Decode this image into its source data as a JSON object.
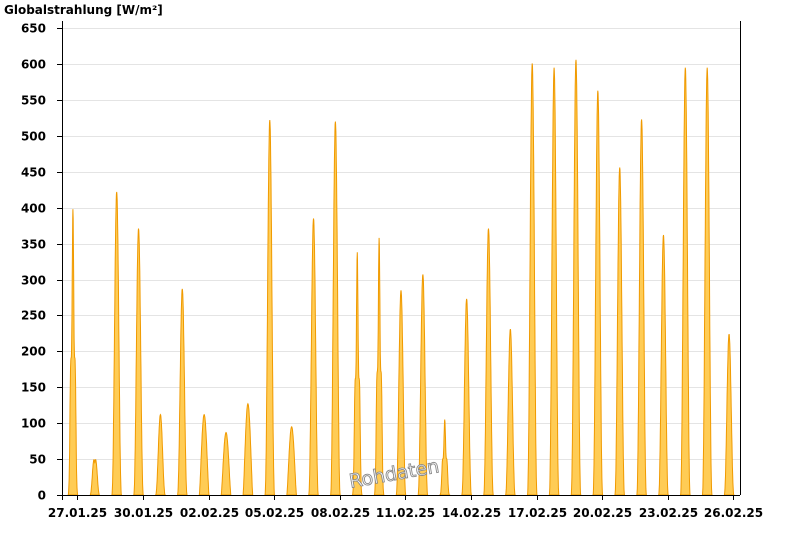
{
  "chart_data": {
    "type": "area",
    "ylabel": "Globalstrahlung [W/m²]",
    "xlabel": "",
    "ylim": [
      0,
      660
    ],
    "yticks": [
      0,
      50,
      100,
      150,
      200,
      250,
      300,
      350,
      400,
      450,
      500,
      550,
      600,
      650
    ],
    "x_start_day": 26.3,
    "x_end_day": 57.3,
    "xticks": [
      {
        "label": "27.01.25",
        "day": 27
      },
      {
        "label": "30.01.25",
        "day": 30
      },
      {
        "label": "02.02.25",
        "day": 33
      },
      {
        "label": "05.02.25",
        "day": 36
      },
      {
        "label": "08.02.25",
        "day": 39
      },
      {
        "label": "11.02.25",
        "day": 42
      },
      {
        "label": "14.02.25",
        "day": 45
      },
      {
        "label": "17.02.25",
        "day": 48
      },
      {
        "label": "20.02.25",
        "day": 51
      },
      {
        "label": "23.02.25",
        "day": 54
      },
      {
        "label": "26.02.25",
        "day": 57
      }
    ],
    "fill_color": "#ffcc55",
    "stroke_color": "#f09a00",
    "grid": true,
    "watermark": "Rohdaten",
    "series": [
      {
        "date": "27.01.25",
        "peak": 398,
        "shape": "spiky"
      },
      {
        "date": "28.01.25",
        "peak": 63,
        "shape": "double"
      },
      {
        "date": "29.01.25",
        "peak": 422,
        "shape": "normal"
      },
      {
        "date": "30.01.25",
        "peak": 371,
        "shape": "normal"
      },
      {
        "date": "31.01.25",
        "peak": 112,
        "shape": "normal"
      },
      {
        "date": "01.02.25",
        "peak": 287,
        "shape": "normal"
      },
      {
        "date": "02.02.25",
        "peak": 112,
        "shape": "flat"
      },
      {
        "date": "03.02.25",
        "peak": 87,
        "shape": "flat"
      },
      {
        "date": "04.02.25",
        "peak": 127,
        "shape": "flat"
      },
      {
        "date": "05.02.25",
        "peak": 522,
        "shape": "normal"
      },
      {
        "date": "06.02.25",
        "peak": 95,
        "shape": "flat"
      },
      {
        "date": "07.02.25",
        "peak": 385,
        "shape": "normal"
      },
      {
        "date": "08.02.25",
        "peak": 520,
        "shape": "normal"
      },
      {
        "date": "09.02.25",
        "peak": 338,
        "shape": "spiky"
      },
      {
        "date": "10.02.25",
        "peak": 358,
        "shape": "spiky"
      },
      {
        "date": "11.02.25",
        "peak": 285,
        "shape": "normal"
      },
      {
        "date": "12.02.25",
        "peak": 307,
        "shape": "normal"
      },
      {
        "date": "13.02.25",
        "peak": 105,
        "shape": "spiky"
      },
      {
        "date": "14.02.25",
        "peak": 273,
        "shape": "normal"
      },
      {
        "date": "15.02.25",
        "peak": 371,
        "shape": "normal"
      },
      {
        "date": "16.02.25",
        "peak": 231,
        "shape": "normal"
      },
      {
        "date": "17.02.25",
        "peak": 601,
        "shape": "normal"
      },
      {
        "date": "18.02.25",
        "peak": 595,
        "shape": "normal"
      },
      {
        "date": "19.02.25",
        "peak": 606,
        "shape": "normal"
      },
      {
        "date": "20.02.25",
        "peak": 563,
        "shape": "normal"
      },
      {
        "date": "21.02.25",
        "peak": 456,
        "shape": "normal"
      },
      {
        "date": "22.02.25",
        "peak": 523,
        "shape": "normal"
      },
      {
        "date": "23.02.25",
        "peak": 362,
        "shape": "normal"
      },
      {
        "date": "24.02.25",
        "peak": 595,
        "shape": "normal"
      },
      {
        "date": "25.02.25",
        "peak": 595,
        "shape": "normal"
      },
      {
        "date": "26.02.25",
        "peak": 224,
        "shape": "normal"
      }
    ]
  }
}
